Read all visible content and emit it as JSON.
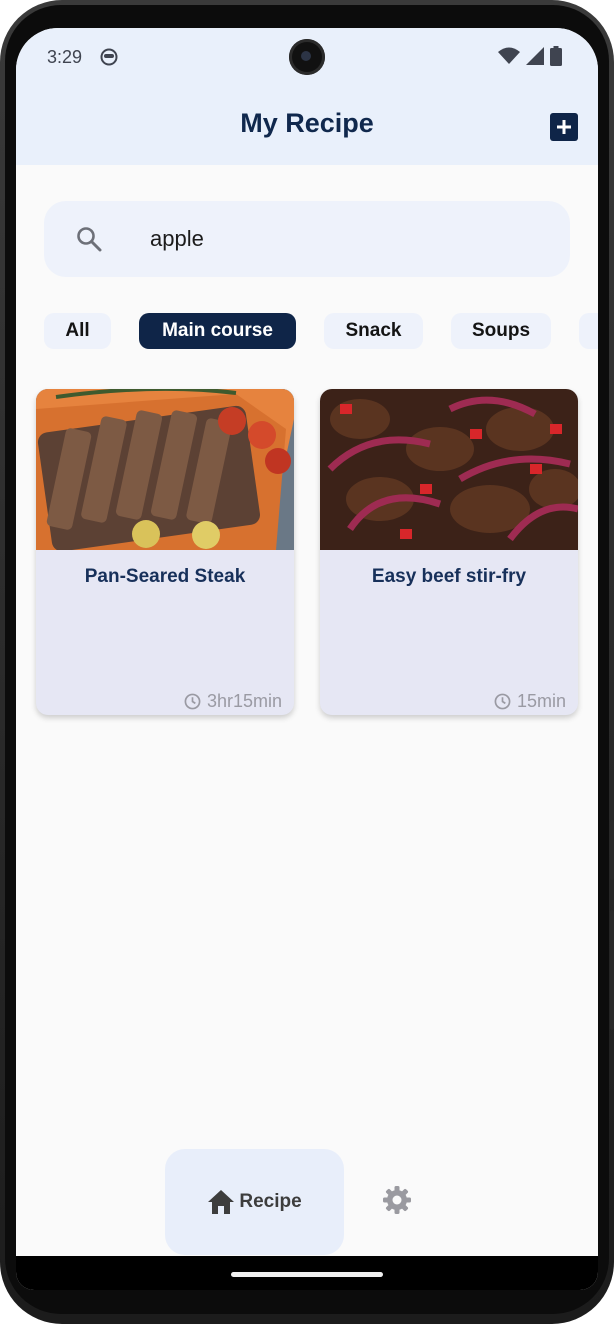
{
  "status_bar": {
    "time": "3:29",
    "notification_icon": "face-icon",
    "icons": [
      "wifi-icon",
      "signal-icon",
      "battery-icon"
    ]
  },
  "app_bar": {
    "title": "My Recipe",
    "add_icon": "add-box-icon"
  },
  "search": {
    "icon": "search-icon",
    "value": "apple"
  },
  "categories": [
    {
      "label": "All",
      "selected": false
    },
    {
      "label": "Main course",
      "selected": true
    },
    {
      "label": "Snack",
      "selected": false
    },
    {
      "label": "Soups",
      "selected": false
    }
  ],
  "recipes": [
    {
      "title": "Pan-Seared Steak",
      "time": "3hr15min",
      "time_icon": "clock-icon"
    },
    {
      "title": "Easy beef stir-fry",
      "time": "15min",
      "time_icon": "clock-icon"
    }
  ],
  "bottom_nav": {
    "recipe_label": "Recipe",
    "recipe_icon": "home-icon",
    "settings_icon": "gear-icon"
  },
  "colors": {
    "primary": "#0f2548",
    "title_text": "#10284d",
    "app_bar_bg": "#e9f0fb",
    "card_bg": "#e6e7f4",
    "chip_bg": "#eef2fb"
  }
}
